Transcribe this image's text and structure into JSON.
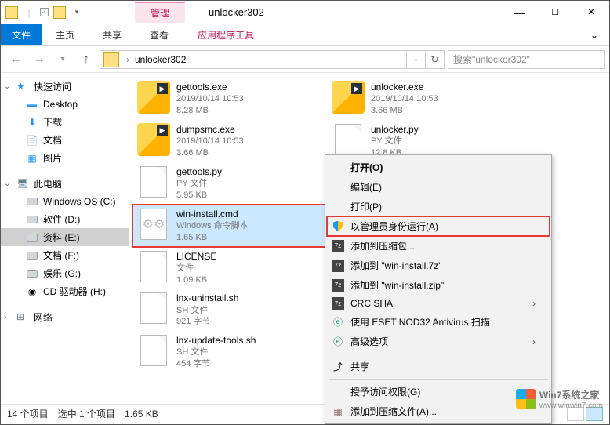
{
  "window": {
    "title": "unlocker302",
    "contextual_tab": "管理"
  },
  "ribbon": {
    "file": "文件",
    "home": "主页",
    "share": "共享",
    "view": "查看",
    "app_tools": "应用程序工具"
  },
  "address": {
    "crumb": "unlocker302"
  },
  "search": {
    "placeholder": "搜索\"unlocker302\""
  },
  "sidebar": {
    "quick": "快速访问",
    "desktop": "Desktop",
    "downloads": "下载",
    "documents": "文档",
    "pictures": "图片",
    "thispc": "此电脑",
    "drives": [
      "Windows OS (C:)",
      "软件 (D:)",
      "资料 (E:)",
      "文档 (F:)",
      "娱乐 (G:)",
      "CD 驱动器 (H:)"
    ],
    "network": "网络"
  },
  "files": [
    {
      "name": "gettools.exe",
      "line2": "2019/10/14 10:53",
      "line3": "8.28 MB",
      "type": "exe"
    },
    {
      "name": "dumpsmc.exe",
      "line2": "2019/10/14 10:53",
      "line3": "3.66 MB",
      "type": "exe"
    },
    {
      "name": "gettools.py",
      "line2": "PY 文件",
      "line3": "5.95 KB",
      "type": "page"
    },
    {
      "name": "win-install.cmd",
      "line2": "Windows 命令脚本",
      "line3": "1.65 KB",
      "type": "gears",
      "selected": true
    },
    {
      "name": "LICENSE",
      "line2": "文件",
      "line3": "1.09 KB",
      "type": "page"
    },
    {
      "name": "lnx-uninstall.sh",
      "line2": "SH 文件",
      "line3": "921 字节",
      "type": "page"
    },
    {
      "name": "lnx-update-tools.sh",
      "line2": "SH 文件",
      "line3": "454 字节",
      "type": "page"
    },
    {
      "name": "unlocker.exe",
      "line2": "2019/10/14 10:53",
      "line3": "3.66 MB",
      "type": "exe"
    },
    {
      "name": "unlocker.py",
      "line2": "PY 文件",
      "line3": "12.8 KB",
      "type": "page"
    }
  ],
  "context_menu": {
    "open": "打开(O)",
    "edit": "编辑(E)",
    "print": "打印(P)",
    "run_admin": "以管理员身份运行(A)",
    "add_archive": "添加到压缩包...",
    "add_7z": "添加到 \"win-install.7z\"",
    "add_zip": "添加到 \"win-install.zip\"",
    "crc": "CRC SHA",
    "eset": "使用 ESET NOD32 Antivirus 扫描",
    "advanced": "高级选项",
    "share": "共享",
    "grant_access": "授予访问权限(G)",
    "add_rar": "添加到压缩文件(A)..."
  },
  "status": {
    "count": "14 个项目",
    "selected": "选中 1 个项目",
    "size": "1.65 KB"
  },
  "watermark": {
    "main": "Win7系统之家",
    "sub": "www.winwin7.com"
  }
}
